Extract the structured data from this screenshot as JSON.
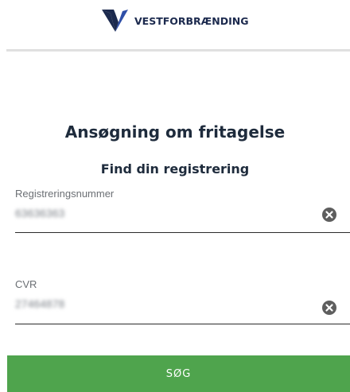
{
  "header": {
    "brand": "VESTFORBRÆNDING",
    "logo_icon": "vestforbraending-v-logo",
    "brand_color": "#1c2a4e",
    "accent_color": "#2f4fa8"
  },
  "page": {
    "title": "Ansøgning om fritagelse",
    "subtitle": "Find din registrering"
  },
  "form": {
    "registration": {
      "label": "Registreringsnummer",
      "value": "63636363",
      "clear_icon": "clear-circle-x-icon"
    },
    "cvr": {
      "label": "CVR",
      "value": "27464878",
      "clear_icon": "clear-circle-x-icon"
    },
    "submit_label": "SØG",
    "submit_color": "#4fa44d"
  }
}
